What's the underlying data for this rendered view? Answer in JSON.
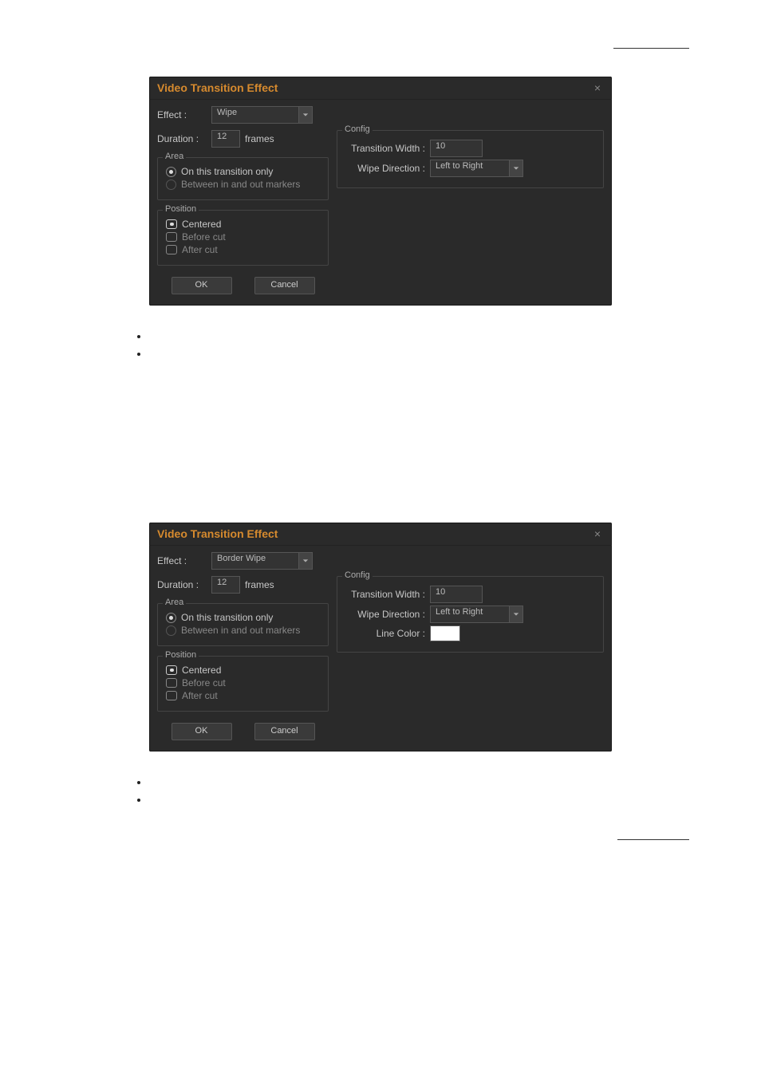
{
  "dialog1": {
    "title": "Video Transition Effect",
    "close_glyph": "×",
    "effect_label": "Effect :",
    "effect_value": "Wipe",
    "duration_label": "Duration :",
    "duration_value": "12",
    "frames_label": "frames",
    "area_legend": "Area",
    "area_opt1": "On this transition only",
    "area_opt2": "Between in and out markers",
    "position_legend": "Position",
    "pos_opt1": "Centered",
    "pos_opt2": "Before cut",
    "pos_opt3": "After cut",
    "ok": "OK",
    "cancel": "Cancel",
    "config_legend": "Config",
    "twidth_label": "Transition Width :",
    "twidth_value": "10",
    "wdir_label": "Wipe Direction :",
    "wdir_value": "Left to Right"
  },
  "dialog2": {
    "title": "Video Transition Effect",
    "close_glyph": "×",
    "effect_label": "Effect :",
    "effect_value": "Border Wipe",
    "duration_label": "Duration :",
    "duration_value": "12",
    "frames_label": "frames",
    "area_legend": "Area",
    "area_opt1": "On this transition only",
    "area_opt2": "Between in and out markers",
    "position_legend": "Position",
    "pos_opt1": "Centered",
    "pos_opt2": "Before cut",
    "pos_opt3": "After cut",
    "ok": "OK",
    "cancel": "Cancel",
    "config_legend": "Config",
    "twidth_label": "Transition Width :",
    "twidth_value": "10",
    "wdir_label": "Wipe Direction :",
    "wdir_value": "Left to Right",
    "linecolor_label": "Line Color :",
    "linecolor_value": "#ffffff"
  }
}
